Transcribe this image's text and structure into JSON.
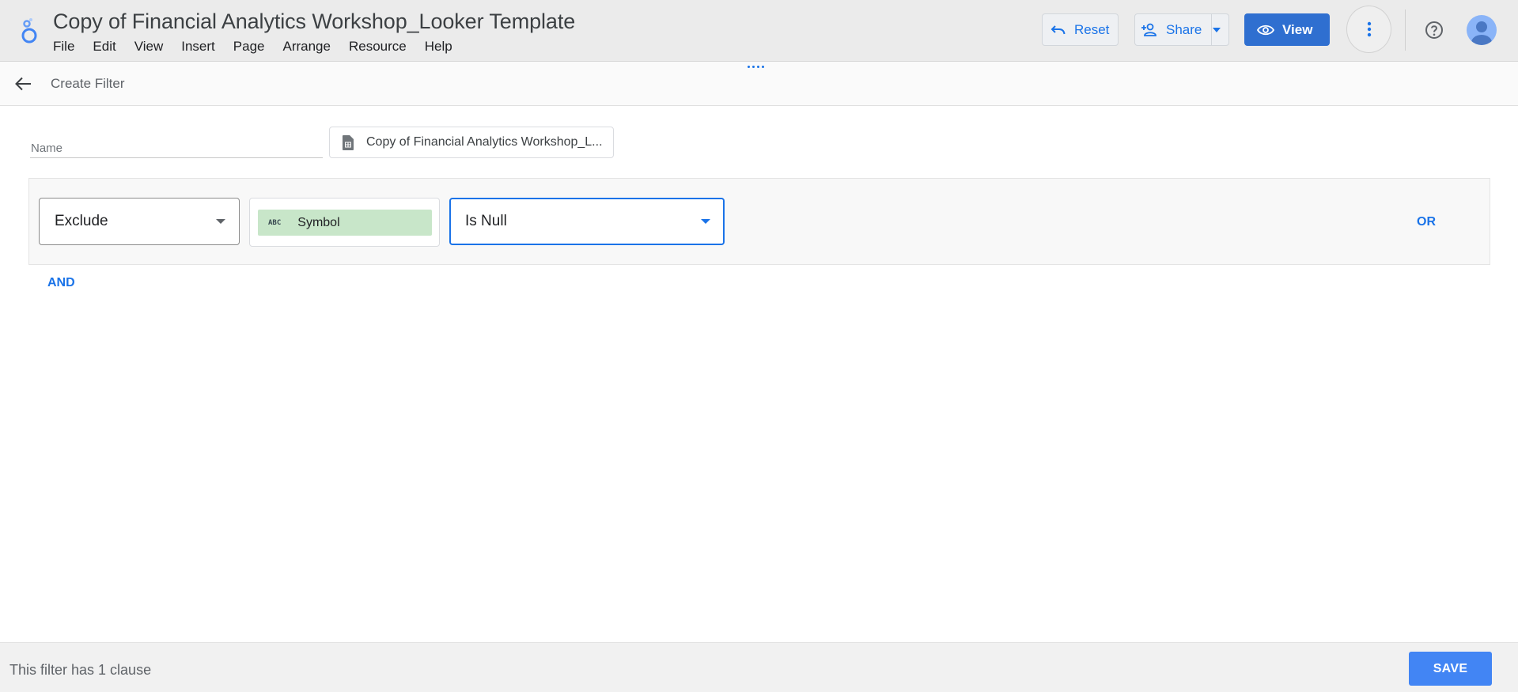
{
  "app": {
    "title": "Copy of Financial Analytics Workshop_Looker Template",
    "menu": [
      "File",
      "Edit",
      "View",
      "Insert",
      "Page",
      "Arrange",
      "Resource",
      "Help"
    ]
  },
  "toolbar": {
    "reset_label": "Reset",
    "share_label": "Share",
    "view_label": "View",
    "accent_color": "#1a73e8",
    "view_button_color": "#2f6fd0"
  },
  "subheader": {
    "title": "Create Filter",
    "back_icon": "arrow-back-icon"
  },
  "filter": {
    "name_placeholder": "Name",
    "name_value": "",
    "datasource": "Copy of Financial Analytics Workshop_L...",
    "datasource_icon": "sheet-icon",
    "clause": {
      "mode": "Exclude",
      "field": "Symbol",
      "field_type_badge": "ABC",
      "field_color": "#c8e6c9",
      "condition": "Is Null",
      "or_label": "OR"
    },
    "and_label": "AND"
  },
  "footer": {
    "status": "This filter has 1 clause",
    "save_label": "SAVE",
    "save_color": "#4285f4"
  }
}
